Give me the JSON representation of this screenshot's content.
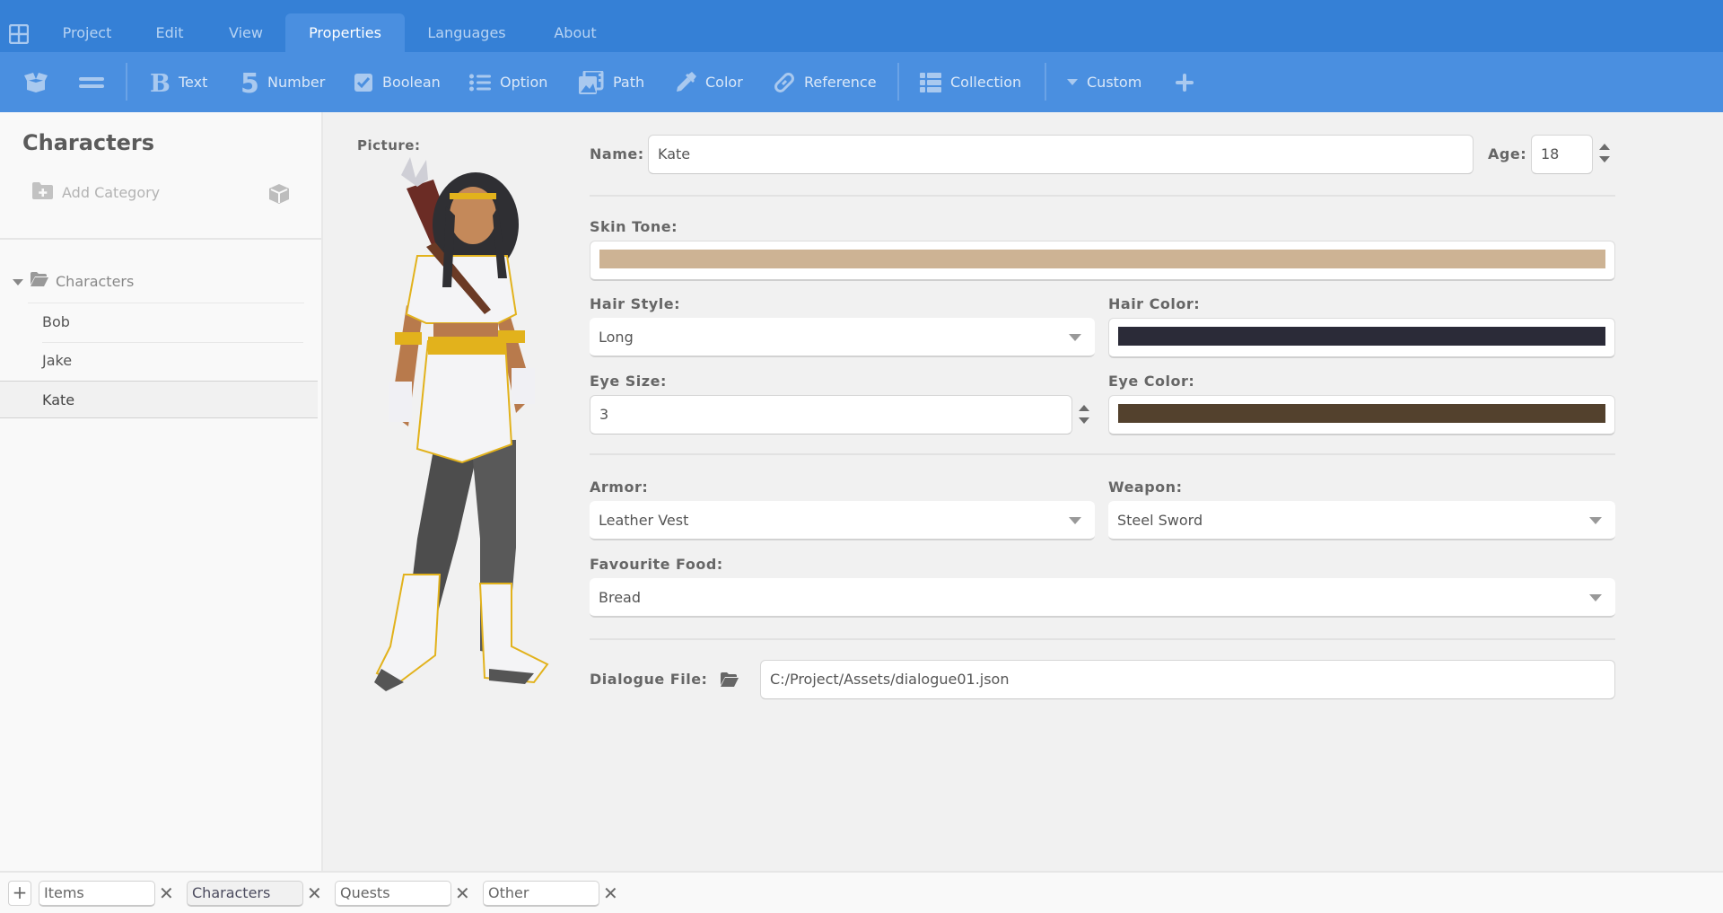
{
  "menubar": {
    "app_icon": "grid-icon",
    "tabs": [
      {
        "label": "Project",
        "active": false
      },
      {
        "label": "Edit",
        "active": false
      },
      {
        "label": "View",
        "active": false
      },
      {
        "label": "Properties",
        "active": true
      },
      {
        "label": "Languages",
        "active": false
      },
      {
        "label": "About",
        "active": false
      }
    ]
  },
  "toolbar": {
    "box_icon": "open-box-icon",
    "menu_icon": "equals-icon",
    "items": [
      {
        "label": "Text",
        "icon": "bold-b-icon"
      },
      {
        "label": "Number",
        "icon": "number-five-icon"
      },
      {
        "label": "Boolean",
        "icon": "checkbox-icon"
      },
      {
        "label": "Option",
        "icon": "list-icon"
      },
      {
        "label": "Path",
        "icon": "image-path-icon"
      },
      {
        "label": "Color",
        "icon": "eyedropper-icon"
      },
      {
        "label": "Reference",
        "icon": "link-icon"
      },
      {
        "label": "Collection",
        "icon": "table-list-icon"
      },
      {
        "label": "Custom",
        "icon": "caret-down-icon"
      }
    ],
    "add_icon": "plus-icon"
  },
  "sidebar": {
    "title": "Characters",
    "add_category": "Add Category",
    "tree": {
      "root": "Characters",
      "expanded": true,
      "items": [
        "Bob",
        "Jake",
        "Kate"
      ],
      "selected": "Kate"
    }
  },
  "form": {
    "picture_label": "Picture:",
    "name_label": "Name:",
    "name_value": "Kate",
    "age_label": "Age:",
    "age_value": "18",
    "skin_tone_label": "Skin Tone:",
    "skin_tone_color": "#cdb394",
    "hair_style_label": "Hair Style:",
    "hair_style_value": "Long",
    "hair_color_label": "Hair Color:",
    "hair_color": "#2b2b38",
    "eye_size_label": "Eye Size:",
    "eye_size_value": "3",
    "eye_color_label": "Eye Color:",
    "eye_color": "#53412d",
    "armor_label": "Armor:",
    "armor_value": "Leather Vest",
    "weapon_label": "Weapon:",
    "weapon_value": "Steel Sword",
    "food_label": "Favourite Food:",
    "food_value": "Bread",
    "dialogue_label": "Dialogue File:",
    "dialogue_value": "C:/Project/Assets/dialogue01.json"
  },
  "bottom_tabs": {
    "add_label": "+",
    "tabs": [
      {
        "label": "Items",
        "active": false
      },
      {
        "label": "Characters",
        "active": true
      },
      {
        "label": "Quests",
        "active": false
      },
      {
        "label": "Other",
        "active": false
      }
    ],
    "close_glyph": "✕"
  },
  "colors": {
    "menubar": "#3580d6",
    "toolbar": "#4a8fe0",
    "active_tab": "#4a8fe0"
  }
}
